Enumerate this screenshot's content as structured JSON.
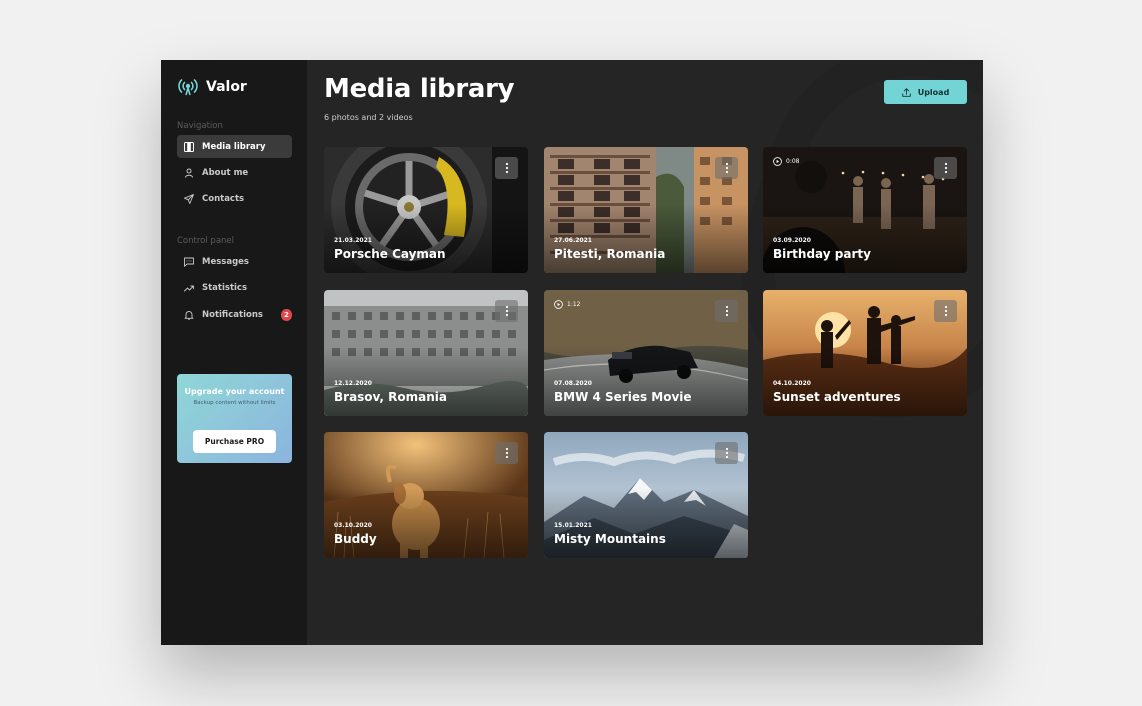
{
  "app": {
    "name": "Valor",
    "accent": "#72d4d4"
  },
  "sidebar": {
    "navigation_label": "Navigation",
    "nav_items": [
      {
        "label": "Media library",
        "icon": "media-icon",
        "active": true
      },
      {
        "label": "About me",
        "icon": "user-icon",
        "active": false
      },
      {
        "label": "Contacts",
        "icon": "send-icon",
        "active": false
      }
    ],
    "control_label": "Control panel",
    "control_items": [
      {
        "label": "Messages",
        "icon": "message-icon"
      },
      {
        "label": "Statistics",
        "icon": "trend-icon"
      },
      {
        "label": "Notifications",
        "icon": "bell-icon",
        "badge": "2"
      }
    ],
    "upgrade": {
      "title": "Upgrade your account",
      "subtitle": "Backup content without limits",
      "button_label": "Purchase PRO"
    }
  },
  "main": {
    "title": "Media library",
    "subtitle": "6 photos and 2 videos",
    "upload_label": "Upload",
    "cards": [
      {
        "date": "21.03.2021",
        "title": "Porsche Cayman",
        "type": "photo"
      },
      {
        "date": "27.06.2021",
        "title": "Pitesti, Romania",
        "type": "photo"
      },
      {
        "date": "03.09.2020",
        "title": "Birthday party",
        "type": "video",
        "duration": "0:08"
      },
      {
        "date": "12.12.2020",
        "title": "Brasov, Romania",
        "type": "photo"
      },
      {
        "date": "07.08.2020",
        "title": "BMW 4 Series Movie",
        "type": "video",
        "duration": "1:12"
      },
      {
        "date": "04.10.2020",
        "title": "Sunset adventures",
        "type": "photo"
      },
      {
        "date": "03.10.2020",
        "title": "Buddy",
        "type": "photo"
      },
      {
        "date": "15.01.2021",
        "title": "Misty Mountains",
        "type": "photo"
      }
    ]
  }
}
